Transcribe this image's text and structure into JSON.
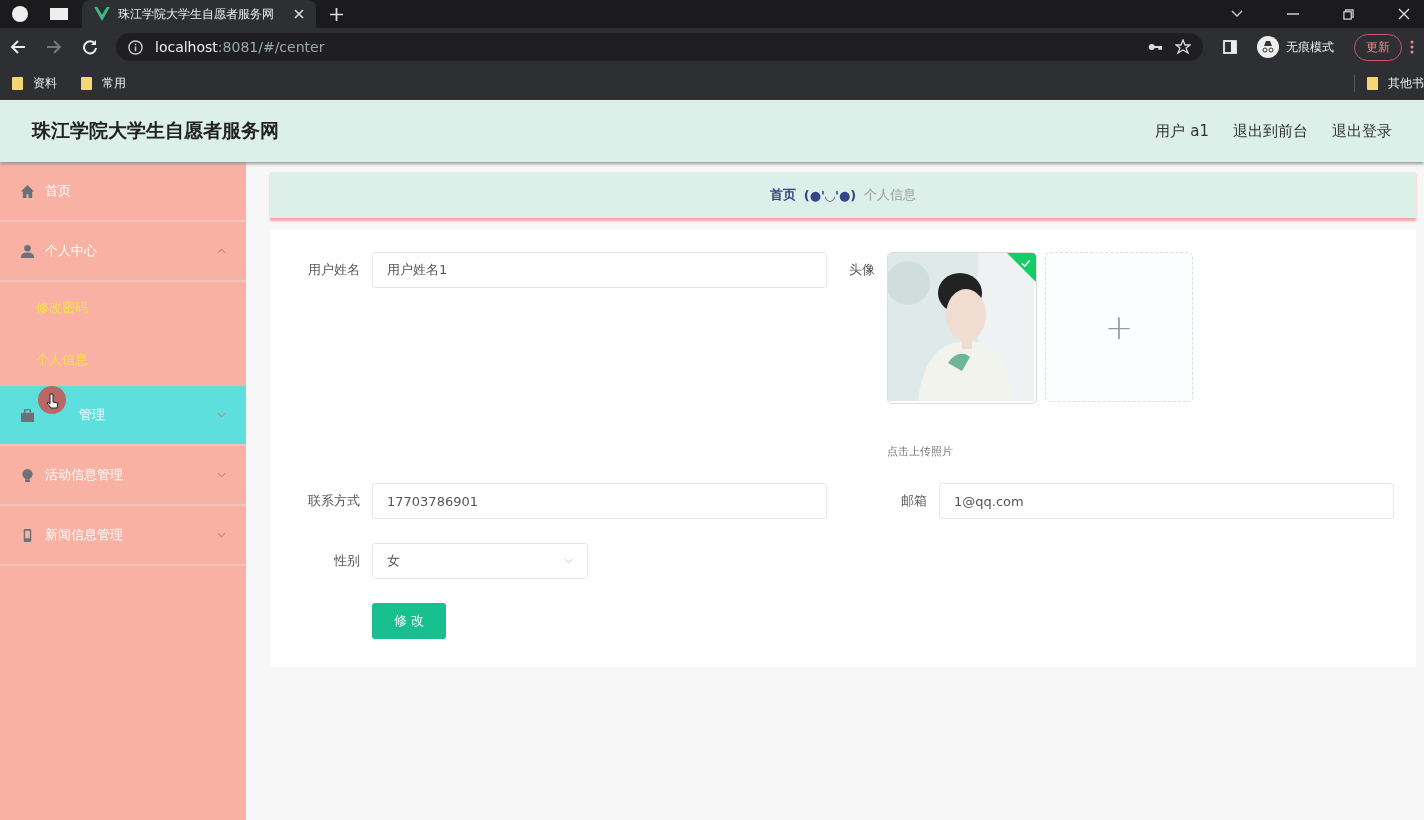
{
  "browser": {
    "tab_title": "珠江学院大学生自愿者服务网",
    "url_host": "localhost",
    "url_rest": ":8081/#/center",
    "incognito": "无痕模式",
    "update": "更新",
    "bookmarks": [
      "资料",
      "常用"
    ],
    "other_bookmarks": "其他书"
  },
  "header": {
    "title": "珠江学院大学生自愿者服务网",
    "links": [
      "用户 a1",
      "退出到前台",
      "退出登录"
    ]
  },
  "sidebar": {
    "items": [
      {
        "label": "首页",
        "selected": false
      },
      {
        "label": "个人中心",
        "selected": false,
        "expanded": true,
        "children": [
          {
            "label": "修改密码"
          },
          {
            "label": "个人信息"
          }
        ]
      },
      {
        "label": "管理",
        "selected": true,
        "expanded": false
      },
      {
        "label": "活动信息管理",
        "selected": false,
        "expanded": false
      },
      {
        "label": "新闻信息管理",
        "selected": false,
        "expanded": false
      }
    ]
  },
  "breadcrumb": {
    "home": "首页",
    "separator": "(●'◡'●)",
    "current": "个人信息"
  },
  "form": {
    "username": {
      "label": "用户姓名",
      "value": "用户姓名1"
    },
    "avatar": {
      "label": "头像",
      "hint": "点击上传照片",
      "add": "+",
      "uploaded": true
    },
    "phone": {
      "label": "联系方式",
      "value": "17703786901"
    },
    "email": {
      "label": "邮箱",
      "value": "1@qq.com"
    },
    "gender": {
      "label": "性别",
      "value": "女"
    },
    "submit": "修 改"
  }
}
